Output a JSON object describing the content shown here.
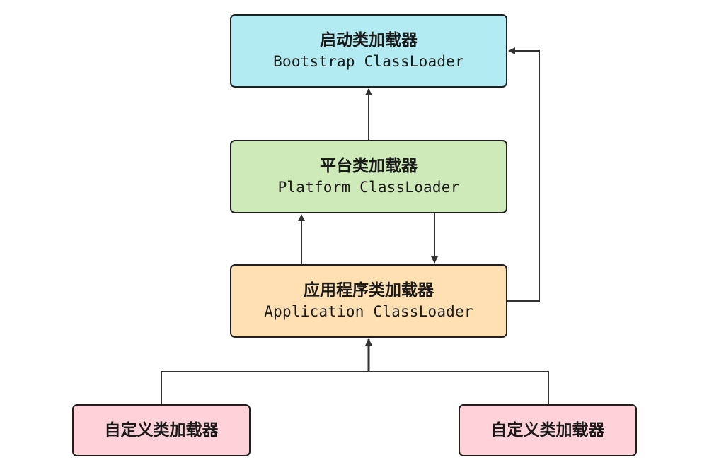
{
  "nodes": {
    "bootstrap": {
      "title": "启动类加载器",
      "subtitle": "Bootstrap ClassLoader",
      "color": "#b2ebf2"
    },
    "platform": {
      "title": "平台类加载器",
      "subtitle": "Platform ClassLoader",
      "color": "#cdeab8"
    },
    "application": {
      "title": "应用程序类加载器",
      "subtitle": "Application ClassLoader",
      "color": "#ffe0b2"
    },
    "custom_left": {
      "title": "自定义类加载器",
      "color": "#ffd1d9"
    },
    "custom_right": {
      "title": "自定义类加载器",
      "color": "#ffd1d9"
    }
  },
  "edges": [
    {
      "from": "platform",
      "to": "bootstrap"
    },
    {
      "from": "application",
      "to": "platform"
    },
    {
      "from": "platform",
      "to": "application"
    },
    {
      "from": "application",
      "to": "bootstrap"
    },
    {
      "from": "custom_left",
      "to": "application"
    },
    {
      "from": "custom_right",
      "to": "application"
    }
  ],
  "colors": {
    "border": "#1f1f1f",
    "arrow": "#333333"
  }
}
